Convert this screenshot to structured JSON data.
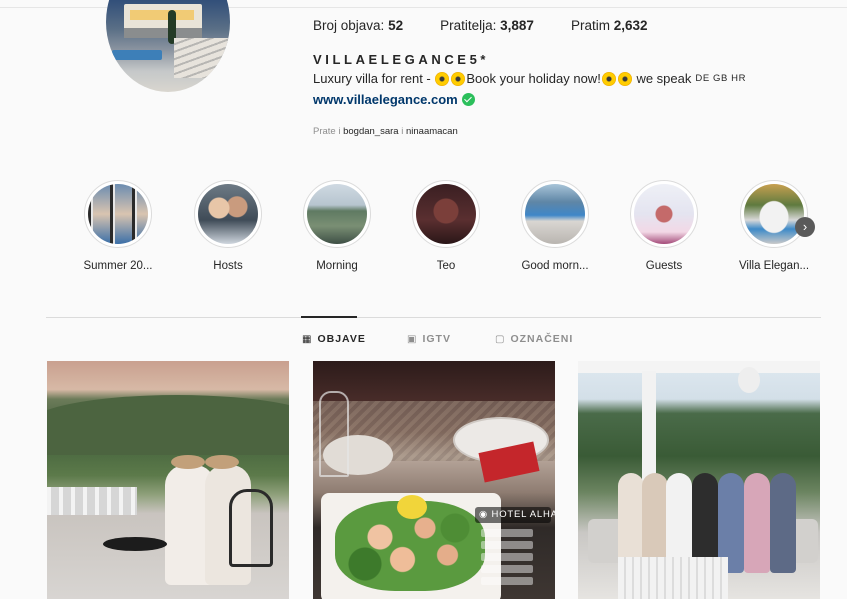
{
  "profile": {
    "stats": {
      "posts_label": "Broj objava:",
      "posts_value": "52",
      "followers_label": "Pratitelja:",
      "followers_value": "3,887",
      "following_label": "Pratim",
      "following_value": "2,632"
    },
    "username": "VILLAELEGANCE5*",
    "bio": {
      "text1": "Luxury villa for rent -",
      "text2": "Book your holiday now!",
      "text3": "we speak",
      "languages": "DE GB HR"
    },
    "website": "www.villaelegance.com",
    "followed_by": {
      "prefix": "Prate i",
      "user1": "bogdan_sara",
      "sep": "i",
      "user2": "ninaamacan"
    }
  },
  "highlights": [
    {
      "label": "Summer 20..."
    },
    {
      "label": "Hosts"
    },
    {
      "label": "Morning"
    },
    {
      "label": "Teo"
    },
    {
      "label": "Good morn..."
    },
    {
      "label": "Guests"
    },
    {
      "label": "Villa Elegan..."
    }
  ],
  "tabs": {
    "posts": "OBJAVE",
    "igtv": "IGTV",
    "tagged": "OZNAČENI"
  },
  "posts": {
    "post2_tag": "HOTEL ALHAR"
  },
  "icons": {
    "grid": "grid-icon",
    "igtv": "igtv-icon",
    "tagged": "tagged-icon",
    "next": "chevron-right-icon",
    "verified": "verified-icon",
    "emoji": "sun-emoji-icon"
  },
  "colors": {
    "link": "#00376b",
    "verified": "#2bbf5b",
    "muted": "#8e8e8e",
    "text": "#262626"
  }
}
